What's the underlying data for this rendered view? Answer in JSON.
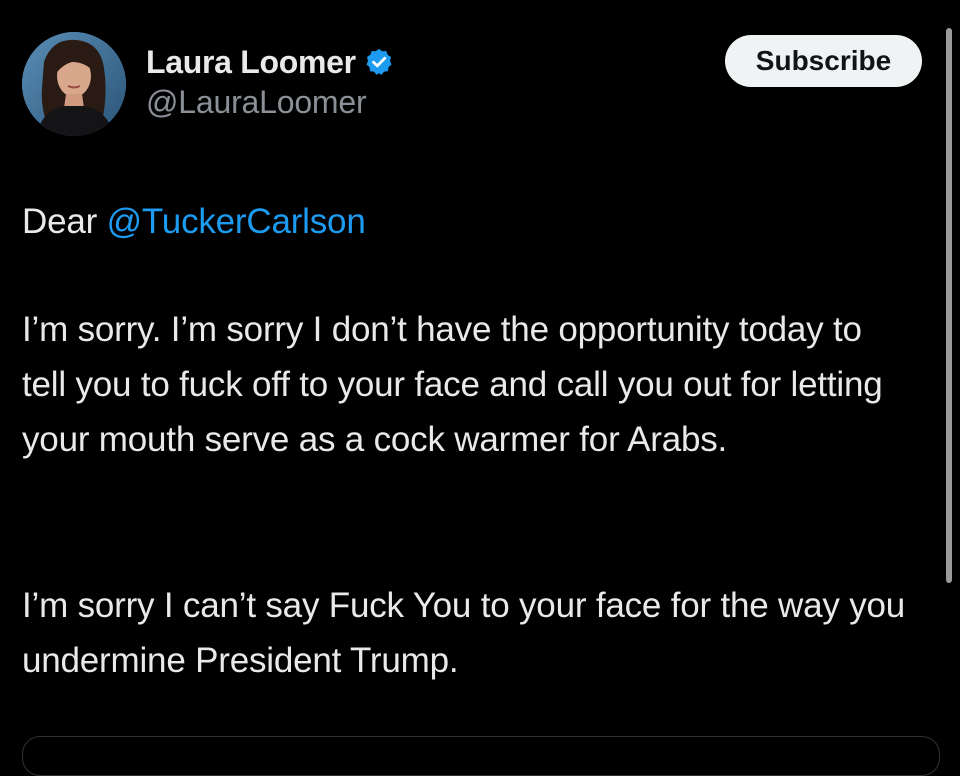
{
  "author": {
    "display_name": "Laura Loomer",
    "handle": "@LauraLoomer",
    "verified": true,
    "avatar": "profile-photo"
  },
  "subscribe_label": "Subscribe",
  "tweet": {
    "greeting_prefix": "Dear ",
    "mention": "@TuckerCarlson",
    "paragraph_2": "I’m sorry. I’m sorry I don’t have the opportunity today to tell you to fuck off to your face and call you out for letting your mouth serve as a cock warmer for Arabs.",
    "paragraph_3": "I’m sorry I can’t say Fuck You to your face for the way you undermine President Trump."
  },
  "colors": {
    "background": "#000000",
    "text": "#e7e9ea",
    "secondary_text": "#8b9096",
    "link": "#1d9bf0",
    "verified_badge": "#1d9bf0",
    "button_bg": "#eff3f4",
    "button_text": "#0f1419"
  }
}
